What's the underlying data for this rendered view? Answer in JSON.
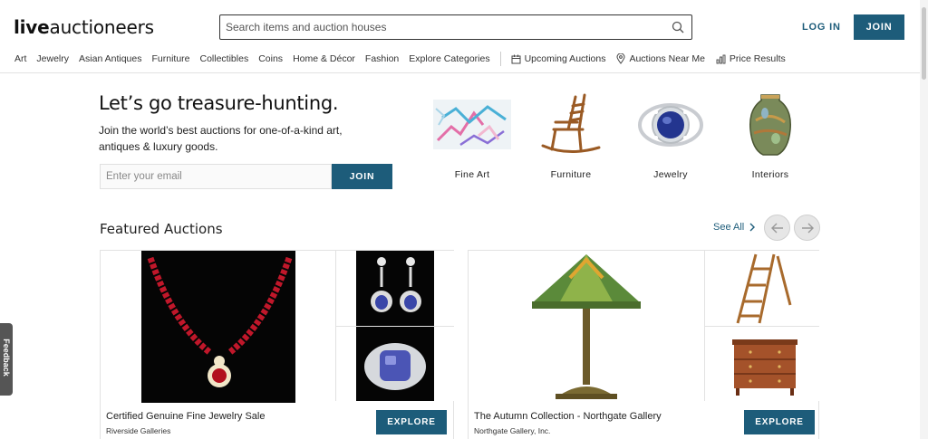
{
  "header": {
    "logo_bold": "live",
    "logo_light": "auctioneers",
    "search_placeholder": "Search items and auction houses",
    "login_label": "LOG IN",
    "join_label": "JOIN"
  },
  "nav": {
    "categories": [
      "Art",
      "Jewelry",
      "Asian Antiques",
      "Furniture",
      "Collectibles",
      "Coins",
      "Home & Décor",
      "Fashion",
      "Explore Categories"
    ],
    "utilities": [
      {
        "label": "Upcoming Auctions",
        "icon": "calendar-icon"
      },
      {
        "label": "Auctions Near Me",
        "icon": "location-pin-icon"
      },
      {
        "label": "Price Results",
        "icon": "bar-chart-icon"
      }
    ]
  },
  "hero": {
    "title": "Let’s go treasure-hunting.",
    "subtitle": "Join the world’s best auctions for one-of-a-kind art, antiques & luxury goods.",
    "email_placeholder": "Enter your email",
    "join_label": "JOIN",
    "categories": [
      {
        "label": "Fine Art"
      },
      {
        "label": "Furniture"
      },
      {
        "label": "Jewelry"
      },
      {
        "label": "Interiors"
      }
    ]
  },
  "featured": {
    "title": "Featured Auctions",
    "see_all_label": "See All",
    "auctions": [
      {
        "name": "Certified Genuine Fine Jewelry Sale",
        "house": "Riverside Galleries",
        "explore_label": "EXPLORE"
      },
      {
        "name": "The Autumn Collection - Northgate Gallery",
        "house": "Northgate Gallery, Inc.",
        "explore_label": "EXPLORE"
      }
    ]
  },
  "feedback_label": "Feedback",
  "colors": {
    "brand": "#1d5c7a",
    "text": "#222222",
    "border": "#e2e2e2"
  }
}
